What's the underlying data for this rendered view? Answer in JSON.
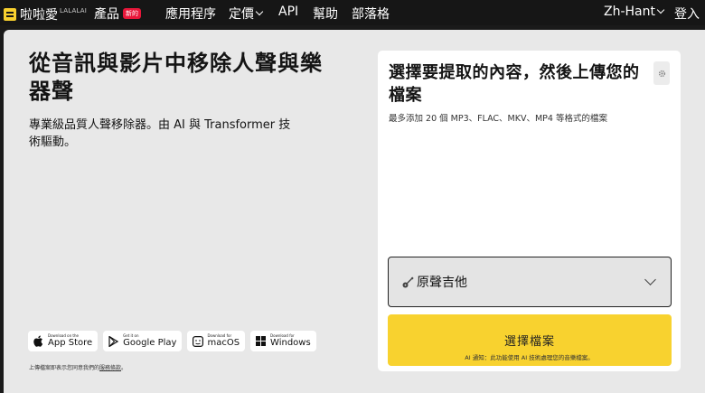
{
  "header": {
    "logo_text": "啦啦愛",
    "logo_sub": "LALALAI",
    "nav": {
      "products": "產品",
      "new_badge": "新的",
      "apps": "應用程序",
      "pricing": "定價",
      "api": "API",
      "help": "幫助",
      "blog": "部落格"
    },
    "language": "Zh-Hant",
    "login": "登入"
  },
  "hero": {
    "title": "從音訊與影片中移除人聲與樂器聲",
    "description": "專業級品質人聲移除器。由 AI 與 Transformer 技術驅動。"
  },
  "stores": [
    {
      "small": "Download on the",
      "big": "App Store",
      "icon": "apple-icon"
    },
    {
      "small": "Get it on",
      "big": "Google Play",
      "icon": "google-play-icon"
    },
    {
      "small": "Download for",
      "big": "macOS",
      "icon": "finder-icon"
    },
    {
      "small": "Download for",
      "big": "Windows",
      "icon": "windows-icon"
    }
  ],
  "terms": {
    "text": "上傳檔案即表示您同意我們的",
    "link": "服務條款",
    "end": "。"
  },
  "upload_card": {
    "title": "選擇要提取的內容，然後上傳您的檔案",
    "subtitle": "最多添加 20 個 MP3、FLAC、MKV、MP4 等格式的檔案",
    "select_value": "原聲吉他",
    "select_icon": "acoustic-guitar-icon",
    "choose_button": "選擇檔案",
    "ai_note": "AI 通知：此功能使用 AI 技術處理您的音樂檔案。"
  },
  "colors": {
    "accent": "#f8d22f",
    "badge": "#e8173a",
    "topbar": "#161616",
    "panel": "#e8e8e8"
  }
}
